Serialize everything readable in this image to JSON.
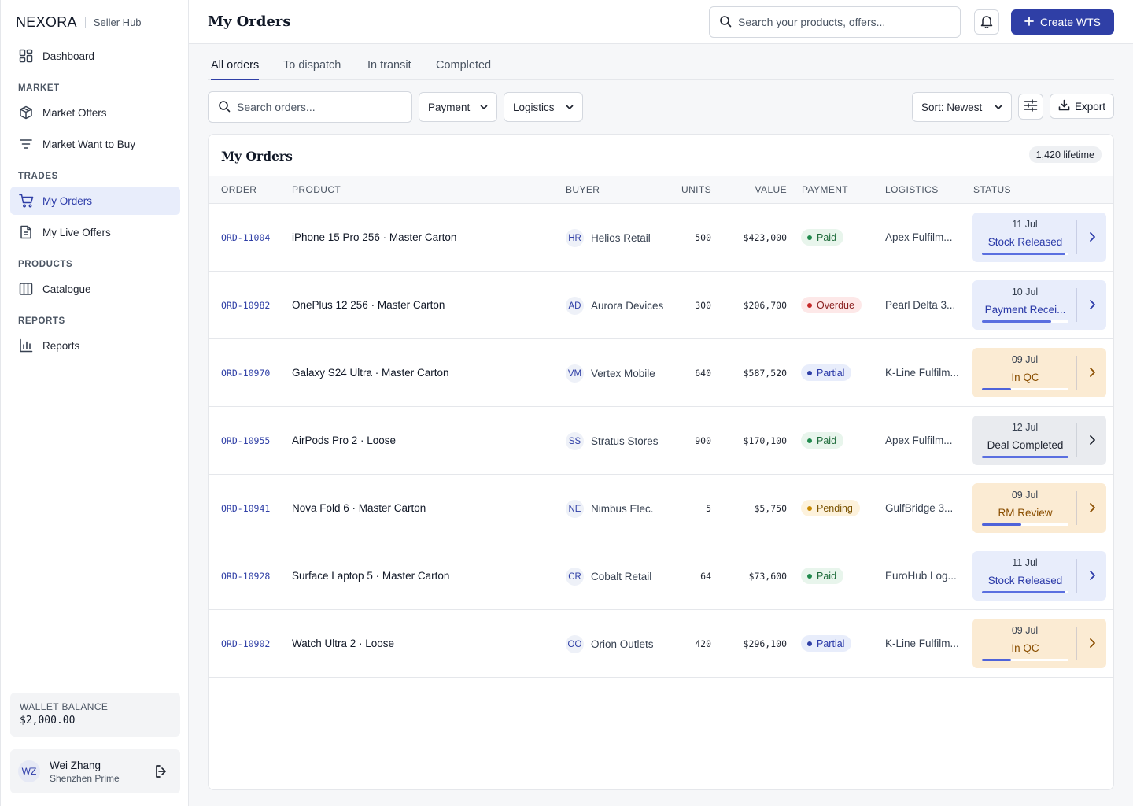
{
  "brand": {
    "logo": "NEXORA",
    "hub": "Seller Hub"
  },
  "nav": {
    "dashboard": "Dashboard",
    "market_label": "MARKET",
    "market_offers": "Market Offers",
    "market_wtb": "Market Want to Buy",
    "trades_label": "TRADES",
    "my_orders": "My Orders",
    "my_live_offers": "My Live Offers",
    "products_label": "PRODUCTS",
    "catalogue": "Catalogue",
    "reports_label": "REPORTS",
    "reports": "Reports"
  },
  "wallet": {
    "label": "WALLET BALANCE",
    "value": "$2,000.00"
  },
  "user": {
    "initials": "WZ",
    "name": "Wei Zhang",
    "org": "Shenzhen Prime"
  },
  "header": {
    "title": "My Orders",
    "search_placeholder": "Search your products, offers...",
    "create_label": "Create WTS"
  },
  "tabs": [
    "All orders",
    "To dispatch",
    "In transit",
    "Completed"
  ],
  "filters": {
    "search_placeholder": "Search orders...",
    "payment": "Payment",
    "logistics": "Logistics",
    "sort": "Sort: Newest",
    "export": "Export"
  },
  "table": {
    "title": "My Orders",
    "lifetime": "1,420 lifetime",
    "headers": {
      "order": "ORDER",
      "product": "PRODUCT",
      "buyer": "BUYER",
      "units": "UNITS",
      "value": "VALUE",
      "payment": "PAYMENT",
      "logistics": "LOGISTICS",
      "status": "STATUS"
    },
    "rows": [
      {
        "order": "ORD-11004",
        "product": "iPhone 15 Pro 256 · Master Carton",
        "buyer_initials": "HR",
        "buyer": "Helios Retail",
        "units": "500",
        "value": "$423,000",
        "payment": "Paid",
        "logistics": "Apex Fulfilm...",
        "date": "11 Jul",
        "status": "Stock Released",
        "progress": 0.96
      },
      {
        "order": "ORD-10982",
        "product": "OnePlus 12 256 · Master Carton",
        "buyer_initials": "AD",
        "buyer": "Aurora Devices",
        "units": "300",
        "value": "$206,700",
        "payment": "Overdue",
        "logistics": "Pearl Delta 3...",
        "date": "10 Jul",
        "status": "Payment Recei...",
        "progress": 0.8
      },
      {
        "order": "ORD-10970",
        "product": "Galaxy S24 Ultra · Master Carton",
        "buyer_initials": "VM",
        "buyer": "Vertex Mobile",
        "units": "640",
        "value": "$587,520",
        "payment": "Partial",
        "logistics": "K-Line Fulfilm...",
        "date": "09 Jul",
        "status": "In QC",
        "progress": 0.34
      },
      {
        "order": "ORD-10955",
        "product": "AirPods Pro 2 · Loose",
        "buyer_initials": "SS",
        "buyer": "Stratus Stores",
        "units": "900",
        "value": "$170,100",
        "payment": "Paid",
        "logistics": "Apex Fulfilm...",
        "date": "12 Jul",
        "status": "Deal Completed",
        "progress": 1.0
      },
      {
        "order": "ORD-10941",
        "product": "Nova Fold 6 · Master Carton",
        "buyer_initials": "NE",
        "buyer": "Nimbus Elec.",
        "units": "5",
        "value": "$5,750",
        "payment": "Pending",
        "logistics": "GulfBridge 3...",
        "date": "09 Jul",
        "status": "RM Review",
        "progress": 0.45
      },
      {
        "order": "ORD-10928",
        "product": "Surface Laptop 5 · Master Carton",
        "buyer_initials": "CR",
        "buyer": "Cobalt Retail",
        "units": "64",
        "value": "$73,600",
        "payment": "Paid",
        "logistics": "EuroHub Log...",
        "date": "11 Jul",
        "status": "Stock Released",
        "progress": 0.96
      },
      {
        "order": "ORD-10902",
        "product": "Watch Ultra 2 · Loose",
        "buyer_initials": "OO",
        "buyer": "Orion Outlets",
        "units": "420",
        "value": "$296,100",
        "payment": "Partial",
        "logistics": "K-Line Fulfilm...",
        "date": "09 Jul",
        "status": "In QC",
        "progress": 0.34
      }
    ]
  },
  "colors": {
    "accent": "#2f3fa6",
    "paid_bg": "#e8f5ec",
    "paid_fg": "#1e6b3a",
    "paid_dot": "#1f8a4c",
    "overdue_bg": "#fde8e8",
    "overdue_fg": "#8a1f1f",
    "overdue_dot": "#c62828",
    "partial_bg": "#e8edfb",
    "partial_fg": "#2b3aa8",
    "partial_dot": "#2f3fa6",
    "pending_bg": "#fdf2dc",
    "pending_fg": "#7a5200",
    "pending_dot": "#c98a00",
    "status_blue_bg": "#e8edfb",
    "status_blue_fg": "#2b3aa8",
    "status_blue_bar": "#5a6fe0",
    "status_amber_bg": "#fbebd3",
    "status_amber_fg": "#8a4e00",
    "status_amber_bar": "#4f63d9",
    "status_gray_bg": "#e9ebef",
    "status_gray_fg": "#1f2430",
    "status_gray_bar": "#5a6fe0"
  }
}
